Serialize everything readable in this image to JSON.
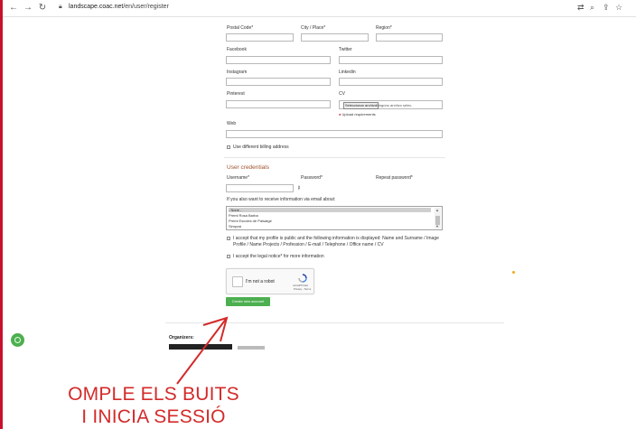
{
  "browser": {
    "url_host": "landscape.coac.net",
    "url_path": "/en/user/register",
    "icons": [
      "back-icon",
      "forward-icon",
      "reload-icon",
      "lock-icon",
      "translate-icon",
      "zoom-icon",
      "share-icon",
      "star-icon"
    ]
  },
  "form": {
    "postal_code_label": "Postal Code*",
    "city_label": "City / Place*",
    "region_label": "Region*",
    "facebook_label": "Facebook",
    "twitter_label": "Twitter",
    "instagram_label": "Instagram",
    "linkedin_label": "Linkedin",
    "pinterest_label": "Pinterest",
    "cv_label": "CV",
    "file_button": "Seleccionar archivo",
    "file_none": "Ningúno archivo selec.",
    "upload_requirements": "Upload requirements",
    "web_label": "Web",
    "billing_label": "Use different billing address"
  },
  "credentials": {
    "title": "User credentials",
    "username_label": "Username*",
    "password_label": "Password*",
    "repeat_password_label": "Repeat password*",
    "info_prompt": "If you also want to receive information via email about:",
    "options": [
      "- None -",
      "Premi Rosa Barba",
      "Premi Escoles de Paisatge",
      "Simposi"
    ],
    "accept_public_line1": "I accept that my profile is public and the following information is displayed: Name and Surname / Image",
    "accept_public_line2": "Profile / Name Projects / Profession / E-mail / Telephone / Office name / CV",
    "accept_legal": "I accept the legal notice* for more information"
  },
  "captcha": {
    "label": "I'm not a robot",
    "brand": "reCAPTCHA",
    "terms": "Privacy - Terms"
  },
  "submit_label": "Create new account",
  "footer": {
    "organizers_label": "Organizers:"
  },
  "annotation": {
    "line1": "OMPLE ELS BUITS",
    "line2": "I INICIA SESSIÓ",
    "color": "#d42a2a"
  }
}
